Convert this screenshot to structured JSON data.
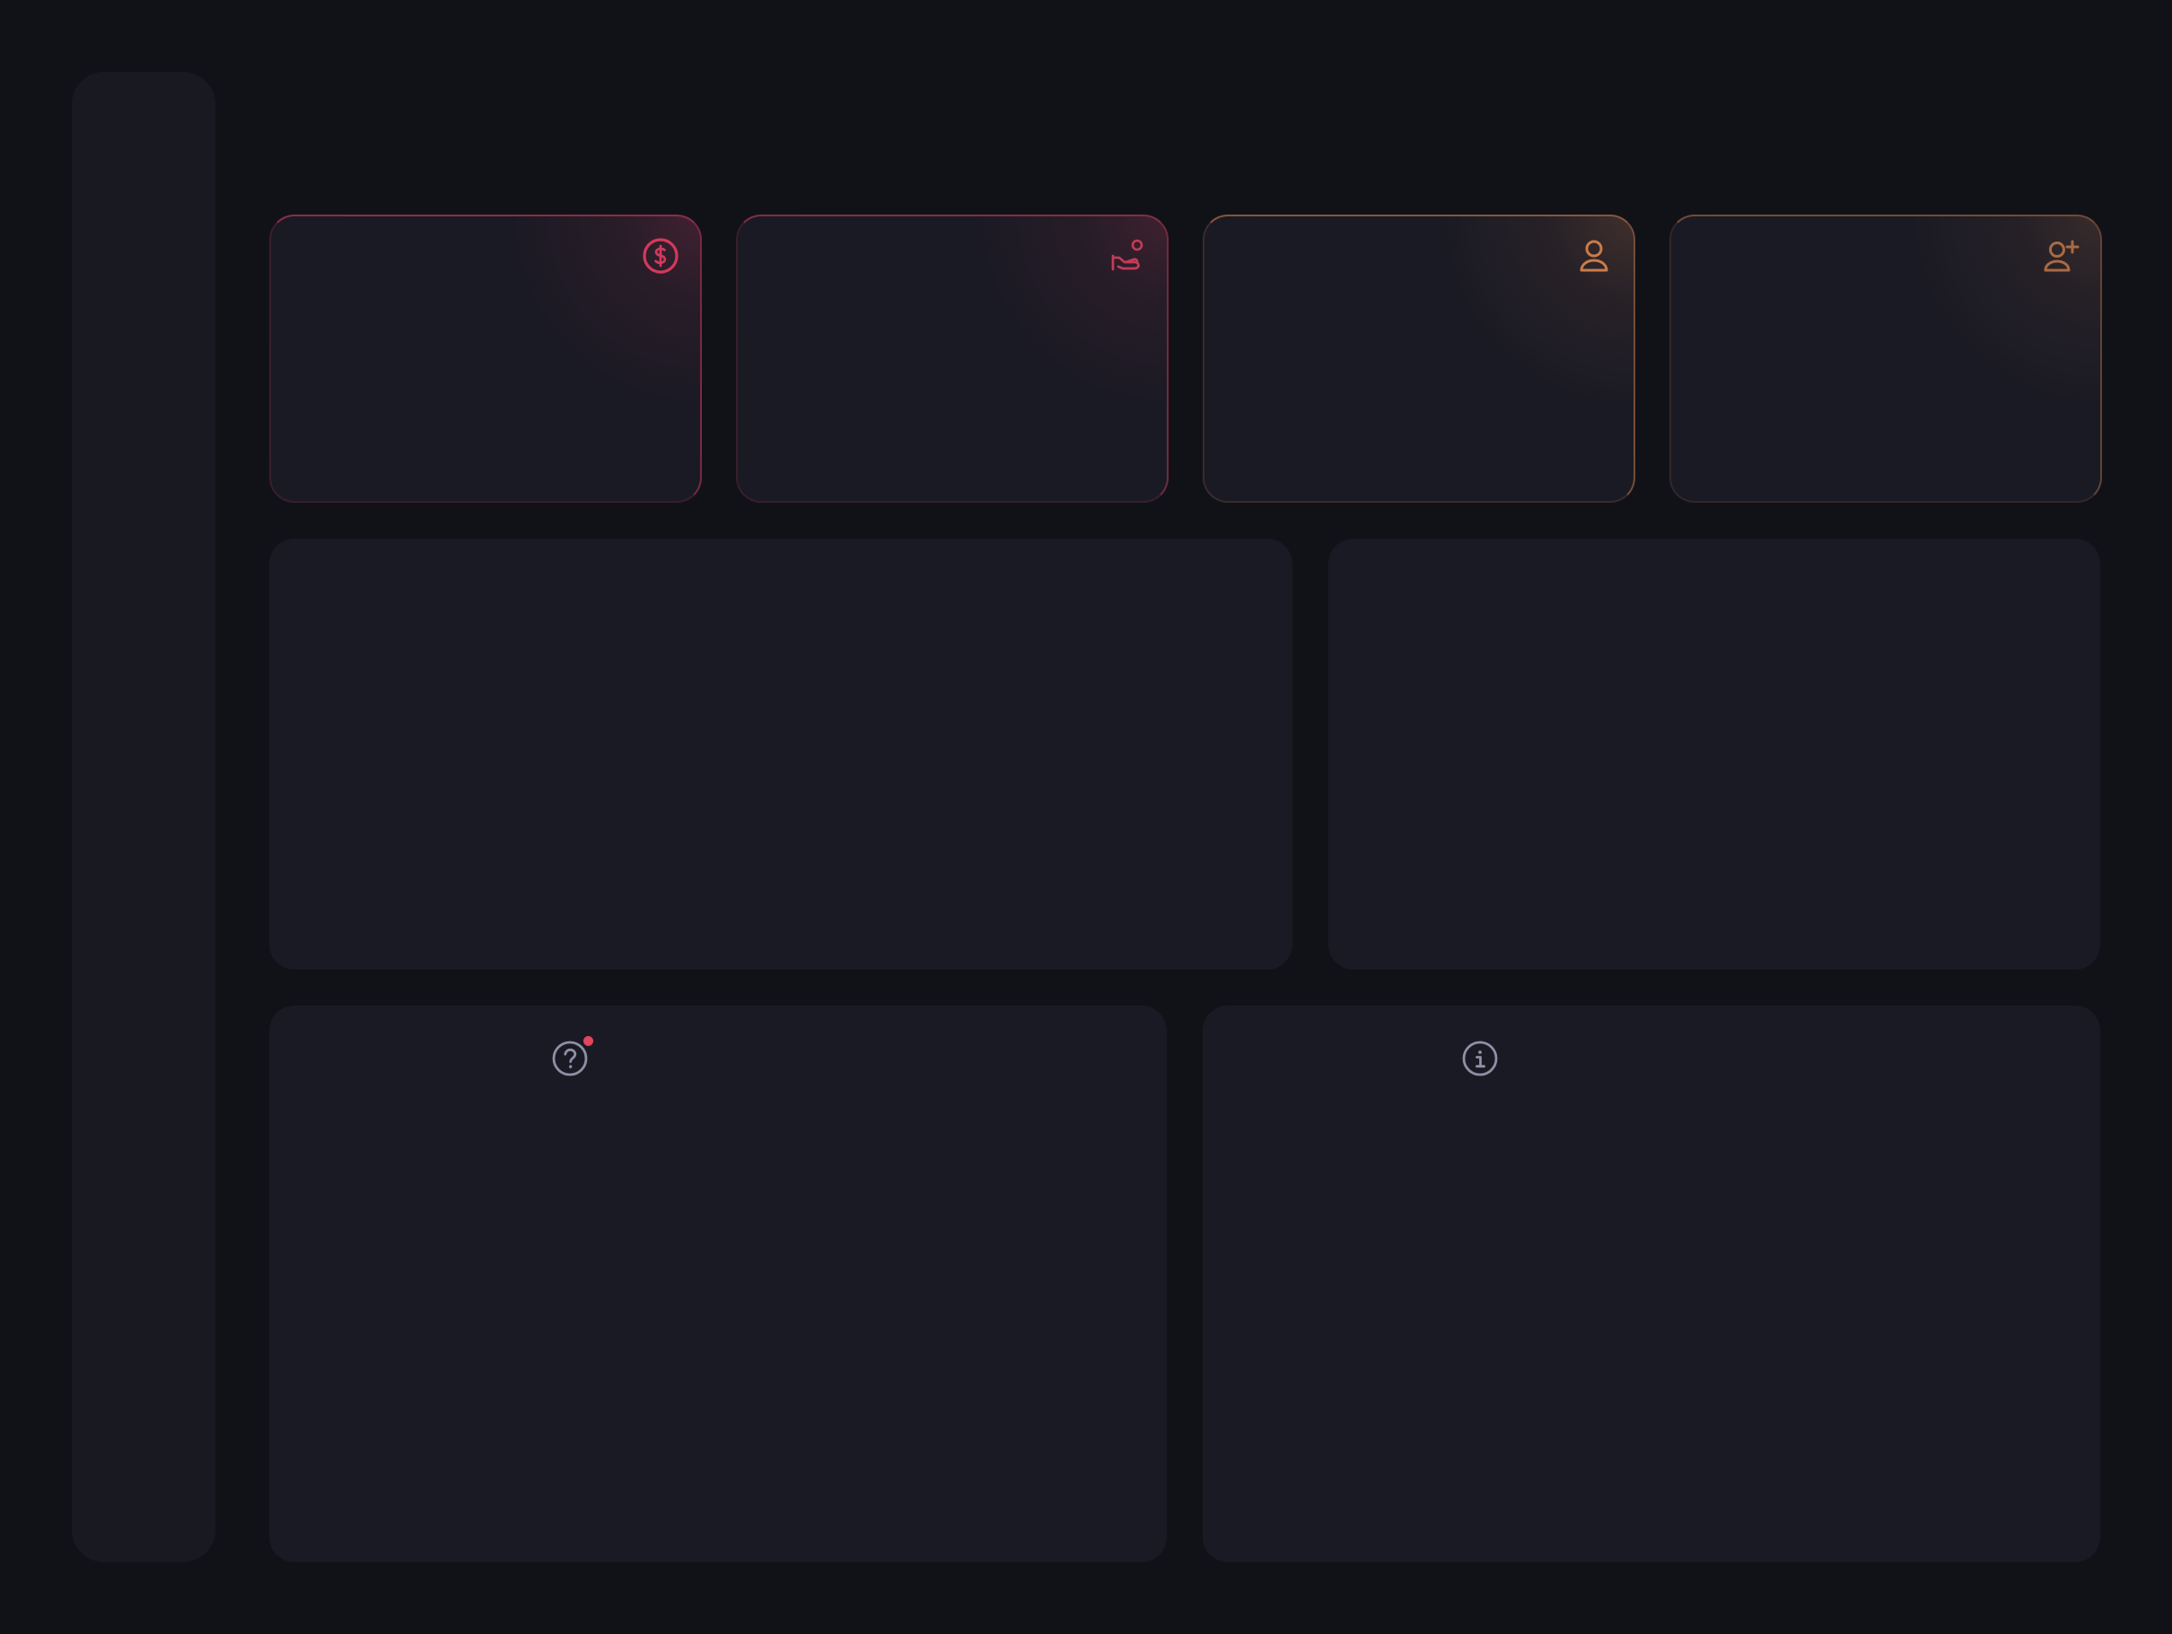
{
  "theme": {
    "background": "#111218",
    "panel": "#1a1a24",
    "sidebar": "#191922",
    "icon_neutral": "#8f8fa6",
    "notification": "#e3455d"
  },
  "sidebar": {
    "items": []
  },
  "stats": [
    {
      "icon": "dollar-circle-icon",
      "accent": "#d23a5d"
    },
    {
      "icon": "hand-coin-icon",
      "accent": "#c43b58"
    },
    {
      "icon": "user-icon",
      "accent": "#c97c4a"
    },
    {
      "icon": "user-plus-icon",
      "accent": "#a86a45"
    }
  ],
  "panels": {
    "main_chart": {},
    "side_chart": {},
    "help_panel": {
      "icon": "help-circle-icon",
      "has_notification": true
    },
    "info_panel": {
      "icon": "info-circle-icon"
    }
  }
}
